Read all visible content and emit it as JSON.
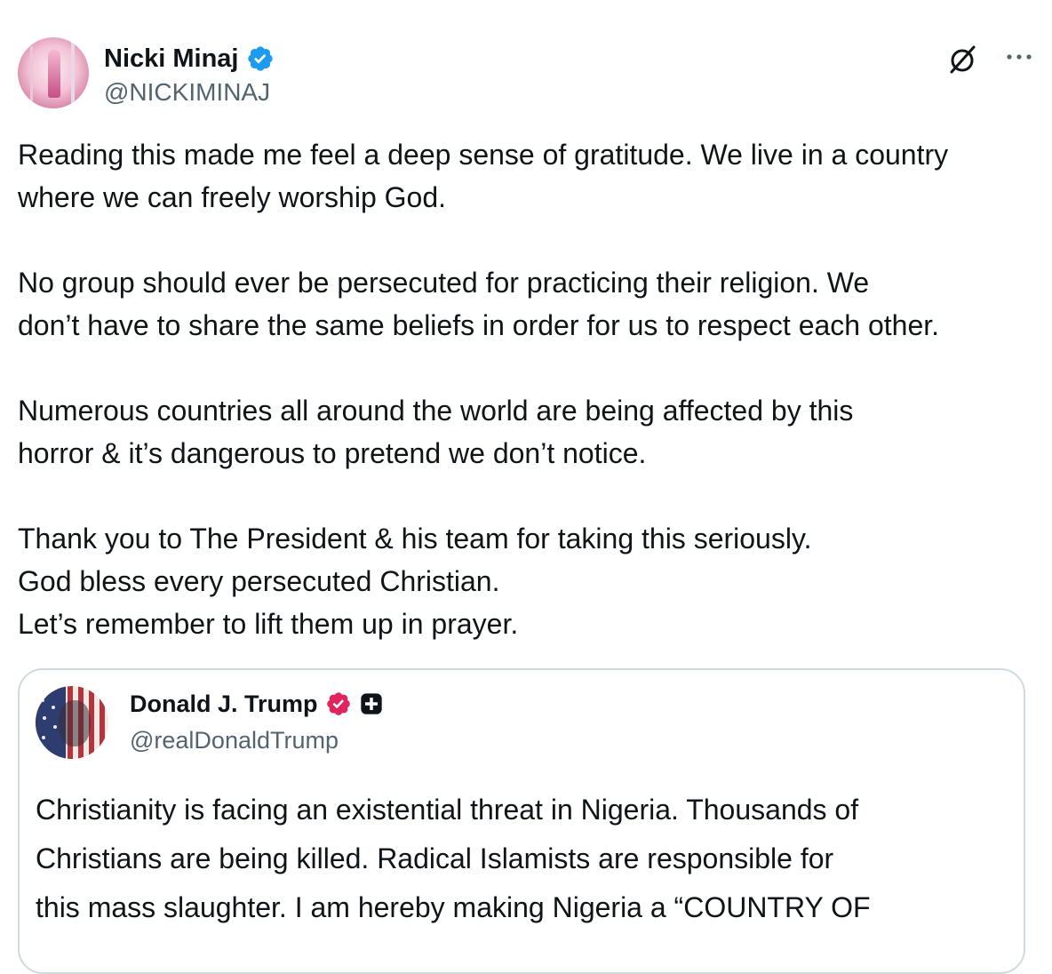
{
  "tweet": {
    "author": {
      "name": "Nicki Minaj",
      "handle": "@NICKIMINAJ"
    },
    "paragraphs": [
      [
        "Reading this made me feel a deep sense of gratitude. We live in a country",
        "where we can freely worship God."
      ],
      [
        "No group should ever be persecuted for practicing their religion. We",
        "don’t have to share the same beliefs in order for us to respect each other."
      ],
      [
        "Numerous countries all around the world are being affected by this",
        "horror & it’s dangerous to pretend we don’t notice."
      ],
      [
        "Thank you to The President & his team for taking this seriously.",
        "God bless every persecuted Christian.",
        "Let’s remember to lift them up in prayer."
      ]
    ]
  },
  "quoted": {
    "author": {
      "name": "Donald J. Trump",
      "handle": "@realDonaldTrump"
    },
    "lines": [
      "Christianity is facing an existential threat in Nigeria. Thousands of",
      "Christians are being killed. Radical Islamists are responsible for",
      "this mass slaughter. I am hereby making Nigeria a “COUNTRY OF"
    ]
  },
  "icons": {
    "verified": "verified-badge-icon",
    "grok": "grok-icon",
    "more": "more-options-icon",
    "government": "government-badge-icon"
  },
  "colors": {
    "verified_blue": "#1d9bf0",
    "handle_gray": "#536471",
    "text": "#0f1419",
    "government_red": "#e0245e",
    "border": "#cfd9de"
  }
}
